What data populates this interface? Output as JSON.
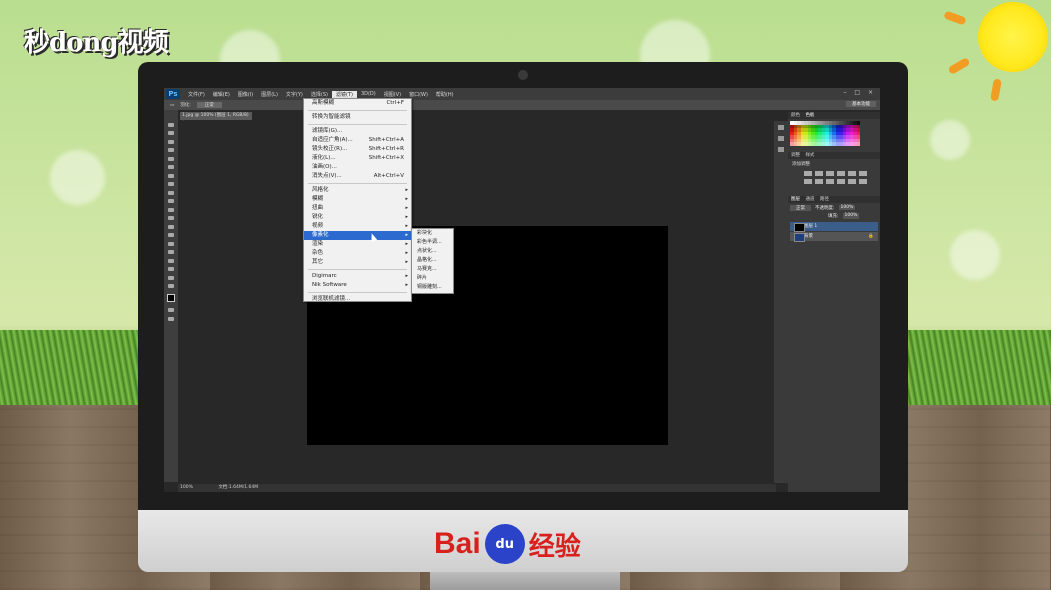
{
  "watermark": {
    "text": "秒dong视频"
  },
  "brand": {
    "b": "Bai",
    "paw": "du",
    "cn": "经验"
  },
  "app": {
    "name": "Ps",
    "menus": [
      "文件(F)",
      "编辑(E)",
      "图像(I)",
      "图层(L)",
      "文字(Y)",
      "选择(S)",
      "滤镜(T)",
      "3D(D)",
      "视图(V)",
      "窗口(W)",
      "帮助(H)"
    ],
    "active_menu_index": 6,
    "window_controls": "– □ ×"
  },
  "options": {
    "feather": "羽化:",
    "style": "正常",
    "workspace": "基本功能"
  },
  "document": {
    "tab_label": "1.jpg @ 100% (图层 1, RGB/8) *",
    "zoom": "100%",
    "doc_size": "文档:1.64M/1.64M"
  },
  "panels": {
    "swatch_tabs": [
      "颜色",
      "色板"
    ],
    "adjust_tabs": [
      "调整",
      "样式"
    ],
    "adjust_title": "添加调整",
    "layer_tabs": [
      "图层",
      "通道",
      "路径"
    ],
    "blend_mode": "正常",
    "opacity_label": "不透明度:",
    "opacity": "100%",
    "fill_label": "填充:",
    "fill": "100%",
    "layers": [
      {
        "name": "图层 1",
        "selected": true
      },
      {
        "name": "背景",
        "selected": false
      }
    ]
  },
  "filter_menu": {
    "groups": [
      [
        {
          "label": "高斯模糊",
          "shortcut": "Ctrl+F"
        }
      ],
      [
        {
          "label": "转换为智能滤镜"
        }
      ],
      [
        {
          "label": "滤镜库(G)..."
        },
        {
          "label": "自适应广角(A)...",
          "shortcut": "Shift+Ctrl+A"
        },
        {
          "label": "镜头校正(R)...",
          "shortcut": "Shift+Ctrl+R"
        },
        {
          "label": "液化(L)...",
          "shortcut": "Shift+Ctrl+X"
        },
        {
          "label": "油画(O)..."
        },
        {
          "label": "消失点(V)...",
          "shortcut": "Alt+Ctrl+V"
        }
      ],
      [
        {
          "label": "风格化",
          "sub": true
        },
        {
          "label": "模糊",
          "sub": true
        },
        {
          "label": "扭曲",
          "sub": true
        },
        {
          "label": "锐化",
          "sub": true
        },
        {
          "label": "视频",
          "sub": true
        },
        {
          "label": "像素化",
          "sub": true,
          "highlight": true
        },
        {
          "label": "渲染",
          "sub": true
        },
        {
          "label": "杂色",
          "sub": true
        },
        {
          "label": "其它",
          "sub": true
        }
      ],
      [
        {
          "label": "Digimarc",
          "sub": true
        },
        {
          "label": "Nik Software",
          "sub": true
        }
      ],
      [
        {
          "label": "浏览联机滤镜..."
        }
      ]
    ]
  },
  "pixelate_submenu": [
    "彩块化",
    "彩色半调...",
    "点状化...",
    "晶格化...",
    "马赛克...",
    "碎片",
    "铜版雕刻..."
  ],
  "colors": {
    "menu_highlight": "#2c6ad0",
    "brand_red": "#d8211c",
    "brand_blue": "#2b43c8"
  }
}
